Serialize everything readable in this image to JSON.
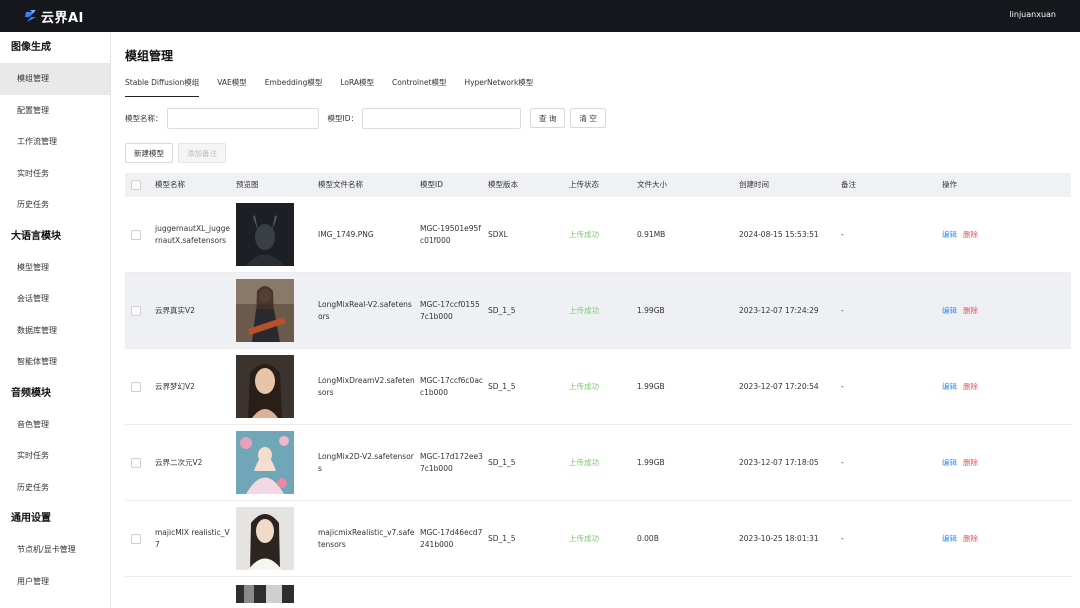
{
  "app": {
    "logo_text": "云界AI",
    "username": "linjuanxuan"
  },
  "sidebar": {
    "groups": [
      {
        "title": "图像生成",
        "items": [
          "模组管理",
          "配置管理",
          "工作流管理",
          "实时任务",
          "历史任务"
        ]
      },
      {
        "title": "大语言模块",
        "items": [
          "模型管理",
          "会话管理",
          "数据库管理",
          "智能体管理"
        ]
      },
      {
        "title": "音频模块",
        "items": [
          "音色管理",
          "实时任务",
          "历史任务"
        ]
      },
      {
        "title": "通用设置",
        "items": [
          "节点机/显卡管理",
          "用户管理"
        ]
      }
    ]
  },
  "main": {
    "title": "模组管理",
    "tabs": [
      "Stable Diffusion模组",
      "VAE模型",
      "Embedding模型",
      "LoRA模型",
      "Controlnet模型",
      "HyperNetwork模型"
    ],
    "search": {
      "name_label": "模型名称：",
      "name_value": "",
      "id_label": "模型ID：",
      "id_value": "",
      "query_btn": "查 询",
      "clear_btn": "清 空"
    },
    "actions": {
      "new_btn": "新建模型",
      "add_note_btn": "添加备注"
    },
    "table": {
      "headers": [
        "模型名称",
        "预览图",
        "模型文件名称",
        "模型ID",
        "模型版本",
        "上传状态",
        "文件大小",
        "创建时间",
        "备注",
        "操作"
      ],
      "ops": {
        "edit": "编辑",
        "delete": "删除"
      },
      "rows": [
        {
          "name": "juggernautXL_juggernautX.safetensors",
          "file": "IMG_1749.PNG",
          "id": "MGC-19501e95fc01f000",
          "version": "SDXL",
          "status": "上传成功",
          "size": "0.91MB",
          "time": "2024-08-15 15:53:51",
          "note": "-",
          "thumb": "dark"
        },
        {
          "name": "云界真实V2",
          "file": "LongMixReal-V2.safetensors",
          "id": "MGC-17ccf01557c1b000",
          "version": "SD_1_5",
          "status": "上传成功",
          "size": "1.99GB",
          "time": "2023-12-07 17:24:29",
          "note": "-",
          "thumb": "guitar"
        },
        {
          "name": "云界梦幻V2",
          "file": "LongMixDreamV2.safetensors",
          "id": "MGC-17ccf6c0acc1b000",
          "version": "SD_1_5",
          "status": "上传成功",
          "size": "1.99GB",
          "time": "2023-12-07 17:20:54",
          "note": "-",
          "thumb": "portrait"
        },
        {
          "name": "云界二次元V2",
          "file": "LongMix2D-V2.safetensors",
          "id": "MGC-17d172ee37c1b000",
          "version": "SD_1_5",
          "status": "上传成功",
          "size": "1.99GB",
          "time": "2023-12-07 17:18:05",
          "note": "-",
          "thumb": "anime"
        },
        {
          "name": "majicMIX realistic_V7",
          "file": "majicmixRealistic_v7.safetensors",
          "id": "MGC-17d46ecd7241b000",
          "version": "SD_1_5",
          "status": "上传成功",
          "size": "0.00B",
          "time": "2023-10-25 18:01:31",
          "note": "-",
          "thumb": "light"
        }
      ]
    }
  },
  "colors": {
    "topbar": "#15171c",
    "status_ok": "#7bc86c",
    "edit": "#3b8ff0",
    "delete": "#f0534f",
    "row_highlight": "#eef0f4"
  }
}
